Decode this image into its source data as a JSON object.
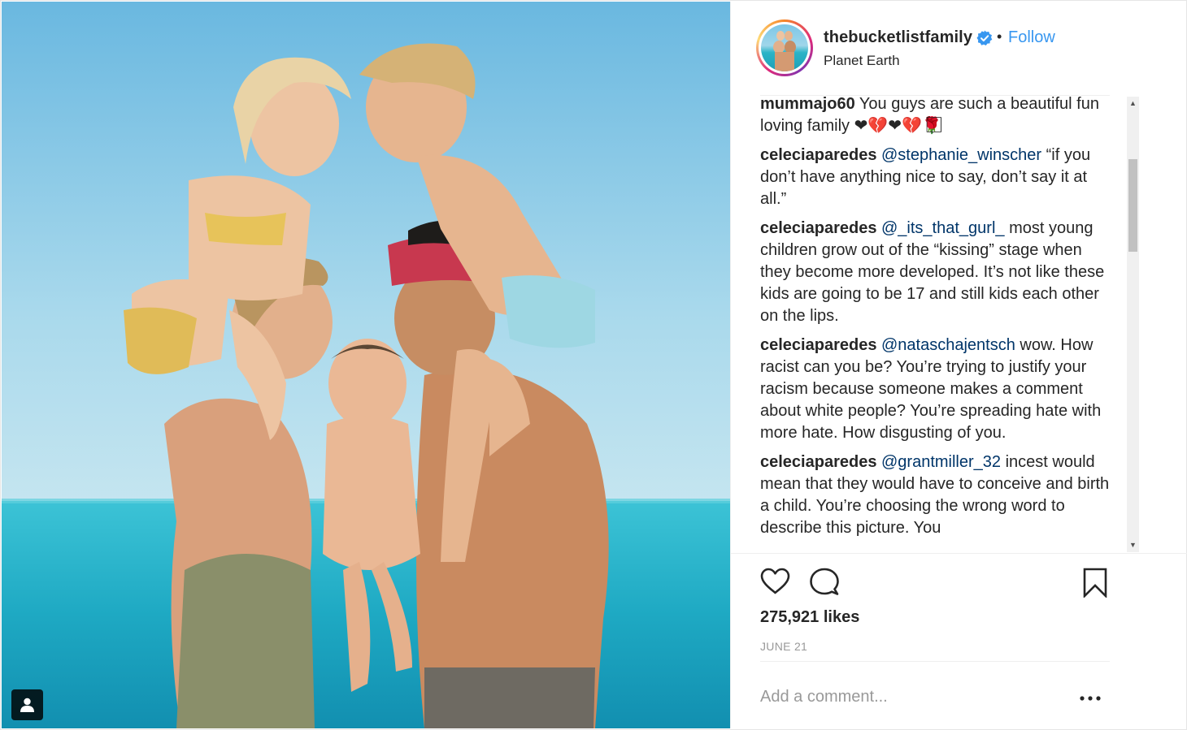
{
  "post": {
    "image_alt": "Family of five kissing on a tropical beach",
    "tag_badge_icon": "person-tag-icon"
  },
  "header": {
    "username": "thebucketlistfamily",
    "verified_icon": "verified-badge-icon",
    "separator": "•",
    "follow_label": "Follow",
    "location": "Planet Earth"
  },
  "comments": [
    {
      "author": "mummajo60",
      "mention": "",
      "text": " You guys are such a beautiful fun loving family ❤💔❤💔🌹⃞⃞⃞"
    },
    {
      "author": "celeciaparedes",
      "mention": "@stephanie_winscher",
      "text": " “if you don’t have anything nice to say, don’t say it at all.”"
    },
    {
      "author": "celeciaparedes",
      "mention": "@_its_that_gurl_",
      "text": " most young children grow out of the “kissing” stage when they become more developed. It’s not like these kids are going to be 17 and still kids each other on the lips."
    },
    {
      "author": "celeciaparedes",
      "mention": "@nataschajentsch",
      "text": " wow. How racist can you be? You’re trying to justify your racism because someone makes a comment about white people? You’re spreading hate with more hate. How disgusting of you."
    },
    {
      "author": "celeciaparedes",
      "mention": "@grantmiller_32",
      "text": " incest would mean that they would have to conceive and birth a child. You’re choosing the wrong word to describe this picture. You"
    }
  ],
  "scrollbar": {
    "up_arrow": "▲",
    "down_arrow": "▼"
  },
  "actions": {
    "like_icon": "heart-icon",
    "comment_icon": "comment-bubble-icon",
    "save_icon": "bookmark-icon"
  },
  "likes": "275,921 likes",
  "date": "JUNE 21",
  "add_comment": {
    "placeholder": "Add a comment...",
    "more_icon": "more-options-icon"
  },
  "colors": {
    "accent_blue": "#3897f0",
    "mention_blue": "#003569",
    "text_primary": "#262626",
    "text_muted": "#999999"
  }
}
